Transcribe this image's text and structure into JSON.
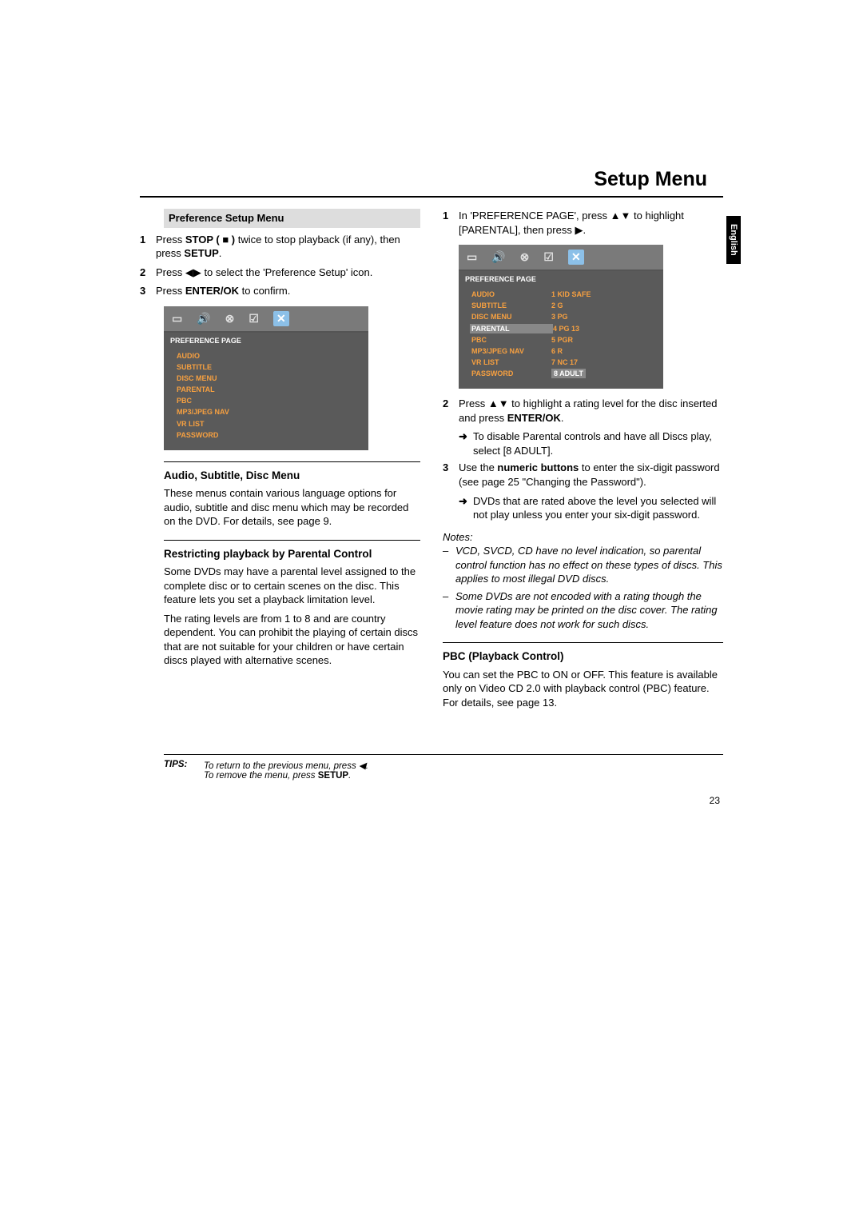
{
  "title": "Setup Menu",
  "language_tab": "English",
  "page_number": "23",
  "left": {
    "section_header": "Preference Setup Menu",
    "steps": [
      {
        "n": "1",
        "pre": "Press ",
        "b1": "STOP ( ■ )",
        "mid": " twice to stop playback (if any), then press ",
        "b2": "SETUP",
        "post": "."
      },
      {
        "n": "2",
        "pre": "Press ◀▶ to select the 'Preference Setup' icon.",
        "b1": "",
        "mid": "",
        "b2": "",
        "post": ""
      },
      {
        "n": "3",
        "pre": "Press ",
        "b1": "ENTER/OK",
        "mid": " to confirm.",
        "b2": "",
        "post": ""
      }
    ],
    "osd1": {
      "header": "PREFERENCE PAGE",
      "items": [
        "AUDIO",
        "SUBTITLE",
        "DISC MENU",
        "PARENTAL",
        "PBC",
        "MP3/JPEG NAV",
        "VR LIST",
        "PASSWORD"
      ]
    },
    "sub1_head": "Audio, Subtitle, Disc Menu",
    "sub1_para": "These menus contain various language options for audio, subtitle and disc menu which may be recorded on the DVD. For details, see page 9.",
    "sub2_head": "Restricting playback by Parental Control",
    "sub2_para1": "Some DVDs may have a parental level assigned to the complete disc or to certain scenes on the disc. This feature lets you set a playback limitation level.",
    "sub2_para2": "The rating levels are from 1 to 8 and are country dependent. You can prohibit the playing of certain discs that are not suitable for your children or have certain discs played with alternative scenes."
  },
  "right": {
    "step1": {
      "n": "1",
      "text": "In 'PREFERENCE PAGE', press ▲▼ to highlight [PARENTAL], then press ▶."
    },
    "osd2": {
      "header": "PREFERENCE PAGE",
      "rows": [
        {
          "label": "AUDIO",
          "val": "1 KID SAFE",
          "hl": false,
          "sel": false
        },
        {
          "label": "SUBTITLE",
          "val": "2 G",
          "hl": false,
          "sel": false
        },
        {
          "label": "DISC MENU",
          "val": "3 PG",
          "hl": false,
          "sel": false
        },
        {
          "label": "PARENTAL",
          "val": "4 PG 13",
          "hl": true,
          "sel": false
        },
        {
          "label": "PBC",
          "val": "5 PGR",
          "hl": false,
          "sel": false
        },
        {
          "label": "MP3/JPEG NAV",
          "val": "6 R",
          "hl": false,
          "sel": false
        },
        {
          "label": "VR LIST",
          "val": "7 NC 17",
          "hl": false,
          "sel": false
        },
        {
          "label": "PASSWORD",
          "val": "8 ADULT",
          "hl": false,
          "sel": true
        }
      ]
    },
    "step2": {
      "n": "2",
      "pre": "Press ▲▼ to highlight a rating level for the disc inserted and press ",
      "b": "ENTER/OK",
      "post": "."
    },
    "step2_sub": "To disable Parental controls and have all Discs play, select [8 ADULT].",
    "step3": {
      "n": "3",
      "pre": "Use the ",
      "b": "numeric buttons",
      "post": " to enter the six-digit password (see page 25 \"Changing the Password\")."
    },
    "step3_sub": "DVDs that are rated above the level you selected will not play unless you enter your six-digit password.",
    "notes_title": "Notes:",
    "notes": [
      "VCD, SVCD, CD have no level indication, so parental control function has no effect on these types of discs. This applies to most illegal DVD discs.",
      "Some DVDs are not encoded with a rating though the movie rating may be printed on the disc cover. The rating level feature does not work for such discs."
    ],
    "pbc_head": "PBC (Playback Control)",
    "pbc_para": "You can set the PBC to ON or OFF. This feature is available only on Video CD 2.0 with playback control (PBC) feature. For details, see page 13."
  },
  "tips": {
    "label": "TIPS:",
    "line1_pre": "To return to the previous menu, press ◀.",
    "line2_pre": "To remove the menu, press ",
    "line2_b": "SETUP",
    "line2_post": "."
  }
}
